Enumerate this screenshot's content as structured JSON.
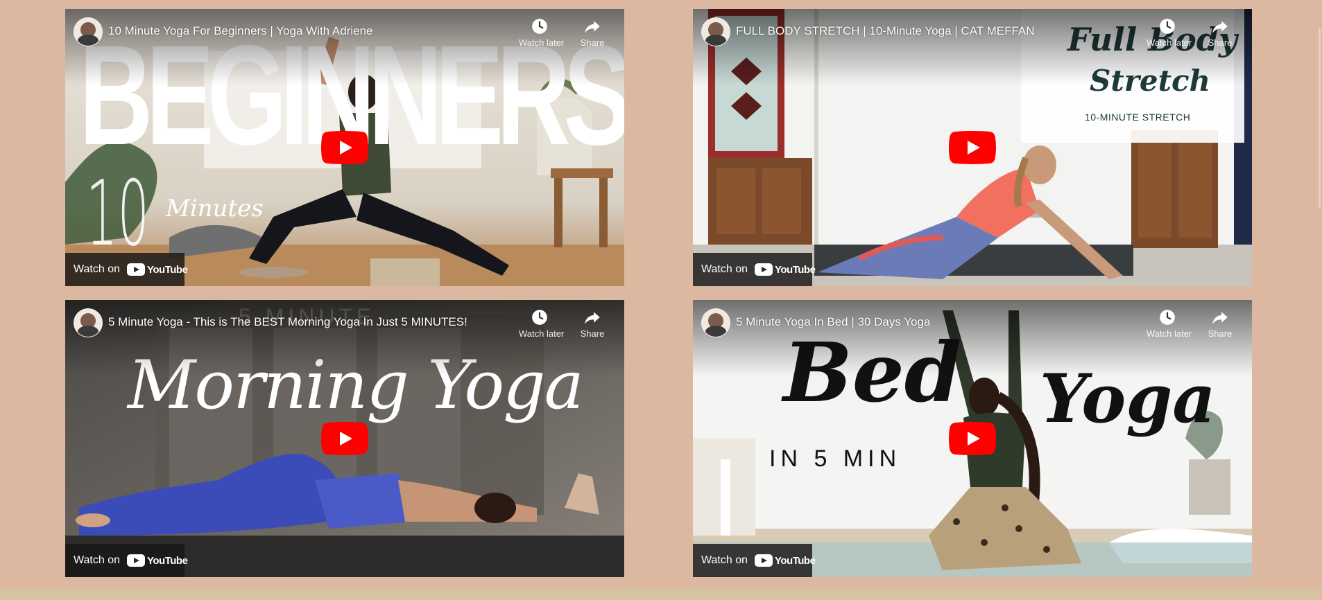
{
  "page": {
    "background": "#ddb8a1",
    "footer_strip_color": "#d7c3a1"
  },
  "common": {
    "watch_later_label": "Watch later",
    "share_label": "Share",
    "watch_on_label": "Watch on",
    "youtube_wordmark": "YouTube",
    "play_button_color": "#ff0000"
  },
  "videos": [
    {
      "title": "10 Minute Yoga For Beginners | Yoga With Adriene",
      "thumbnail_text": {
        "headline": "BEGINNERS",
        "number": "10",
        "unit": "Minutes"
      }
    },
    {
      "title": "FULL BODY STRETCH | 10-Minute Yoga | CAT MEFFAN",
      "thumbnail_text": {
        "headline_line1": "Full Body",
        "headline_line2": "Stretch",
        "subline": "10-MINUTE STRETCH"
      }
    },
    {
      "title": "5 Minute Yoga - This is The BEST Morning Yoga In Just 5 MINUTES!",
      "thumbnail_text": {
        "kicker": "5 MINUTE",
        "headline": "Morning Yoga"
      }
    },
    {
      "title": "5 Minute Yoga In Bed | 30 Days Yoga",
      "thumbnail_text": {
        "headline_left": "Bed",
        "headline_right": "Yoga",
        "subline": "IN 5 MIN"
      }
    }
  ]
}
